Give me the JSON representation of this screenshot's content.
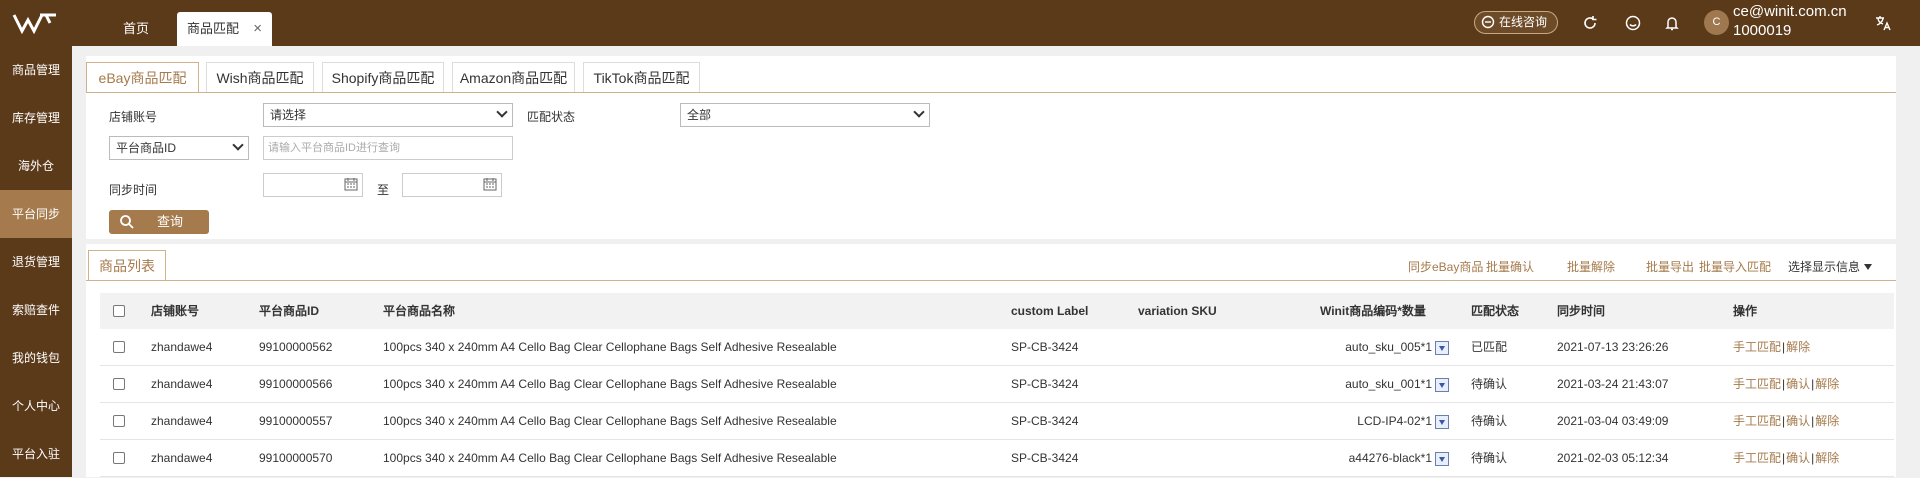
{
  "topbar": {
    "tabs": [
      {
        "label": "首页"
      },
      {
        "label": "商品匹配"
      }
    ],
    "close_glyph": "×",
    "consult_label": "在线咨询",
    "user_email": "ce@winit.com.cn",
    "user_id": "1000019",
    "avatar_letter": "C",
    "icons": [
      "refresh-icon",
      "smiley-icon",
      "bell-icon",
      "translate-icon"
    ]
  },
  "sidebar": {
    "items": [
      {
        "label": "商品管理"
      },
      {
        "label": "库存管理"
      },
      {
        "label": "海外仓"
      },
      {
        "label": "平台同步"
      },
      {
        "label": "退货管理"
      },
      {
        "label": "索赔查件"
      },
      {
        "label": "我的钱包"
      },
      {
        "label": "个人中心"
      },
      {
        "label": "平台入驻"
      }
    ]
  },
  "platform_tabs": [
    {
      "label": "eBay商品匹配"
    },
    {
      "label": "Wish商品匹配"
    },
    {
      "label": "Shopify商品匹配"
    },
    {
      "label": "Amazon商品匹配"
    },
    {
      "label": "TikTok商品匹配"
    }
  ],
  "filters": {
    "store_label": "店铺账号",
    "store_value": "请选择",
    "match_status_label": "匹配状态",
    "match_status_value": "全部",
    "id_type_value": "平台商品ID",
    "id_placeholder": "请输入平台商品ID进行查询",
    "sync_time_label": "同步时间",
    "to_label": "至",
    "search_button": "查询"
  },
  "list": {
    "tab_label": "商品列表",
    "actions": [
      "同步eBay商品",
      "批量确认",
      "批量解除",
      "批量导出",
      "批量导入匹配"
    ],
    "display_select": "选择显示信息",
    "columns": [
      "店铺账号",
      "平台商品ID",
      "平台商品名称",
      "custom Label",
      "variation SKU",
      "Winit商品编码*数量",
      "匹配状态",
      "同步时间",
      "操作"
    ],
    "rows": [
      {
        "store": "zhandawe4",
        "id": "99100000562",
        "name": "100pcs 340 x 240mm A4 Cello Bag Clear Cellophane Bags Self Adhesive Resealable",
        "label": "SP-CB-3424",
        "vsku": "",
        "sku": "auto_sku_005*1",
        "status": "已匹配",
        "time": "2021-07-13 23:26:26",
        "ops": [
          "手工匹配",
          "解除"
        ]
      },
      {
        "store": "zhandawe4",
        "id": "99100000566",
        "name": "100pcs 340 x 240mm A4 Cello Bag Clear Cellophane Bags Self Adhesive Resealable",
        "label": "SP-CB-3424",
        "vsku": "",
        "sku": "auto_sku_001*1",
        "status": "待确认",
        "time": "2021-03-24 21:43:07",
        "ops": [
          "手工匹配",
          "确认",
          "解除"
        ]
      },
      {
        "store": "zhandawe4",
        "id": "99100000557",
        "name": "100pcs 340 x 240mm A4 Cello Bag Clear Cellophane Bags Self Adhesive Resealable",
        "label": "SP-CB-3424",
        "vsku": "",
        "sku": "LCD-IP4-02*1",
        "status": "待确认",
        "time": "2021-03-04 03:49:09",
        "ops": [
          "手工匹配",
          "确认",
          "解除"
        ]
      },
      {
        "store": "zhandawe4",
        "id": "99100000570",
        "name": "100pcs 340 x 240mm A4 Cello Bag Clear Cellophane Bags Self Adhesive Resealable",
        "label": "SP-CB-3424",
        "vsku": "",
        "sku": "a44276-black*1",
        "status": "待确认",
        "time": "2021-02-03 05:12:34",
        "ops": [
          "手工匹配",
          "确认",
          "解除"
        ]
      }
    ],
    "op_separator": "|"
  },
  "colors": {
    "brand": "#5b3a1a",
    "accent": "#a57a4c"
  }
}
